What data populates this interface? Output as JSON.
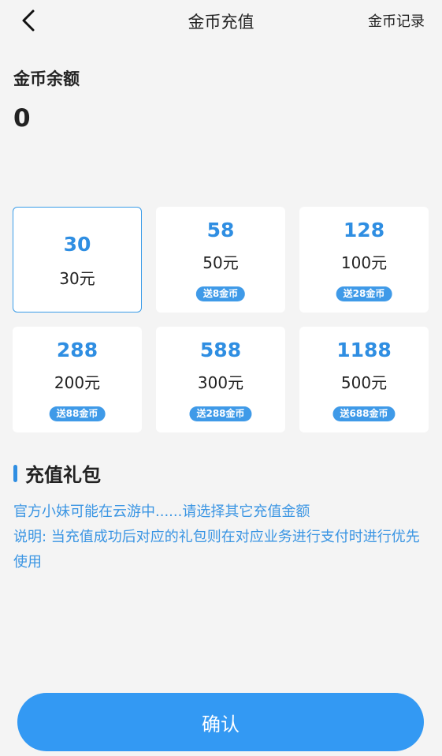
{
  "header": {
    "title": "金币充值",
    "record_link": "金币记录"
  },
  "balance": {
    "label": "金币余额",
    "value": "0"
  },
  "packages": [
    {
      "coins": "30",
      "price": "30元",
      "bonus": "",
      "selected": true
    },
    {
      "coins": "58",
      "price": "50元",
      "bonus": "送8金币",
      "selected": false
    },
    {
      "coins": "128",
      "price": "100元",
      "bonus": "送28金币",
      "selected": false
    },
    {
      "coins": "288",
      "price": "200元",
      "bonus": "送88金币",
      "selected": false
    },
    {
      "coins": "588",
      "price": "300元",
      "bonus": "送288金币",
      "selected": false
    },
    {
      "coins": "1188",
      "price": "500元",
      "bonus": "送688金币",
      "selected": false
    }
  ],
  "gift_section": {
    "title": "充值礼包",
    "notice": "官方小妹可能在云游中......请选择其它充值金额",
    "explanation": "说明: 当充值成功后对应的礼包则在对应业务进行支付时进行优先使用"
  },
  "confirm_label": "确认",
  "colors": {
    "accent": "#3399f3",
    "text_link": "#3a95e3"
  }
}
